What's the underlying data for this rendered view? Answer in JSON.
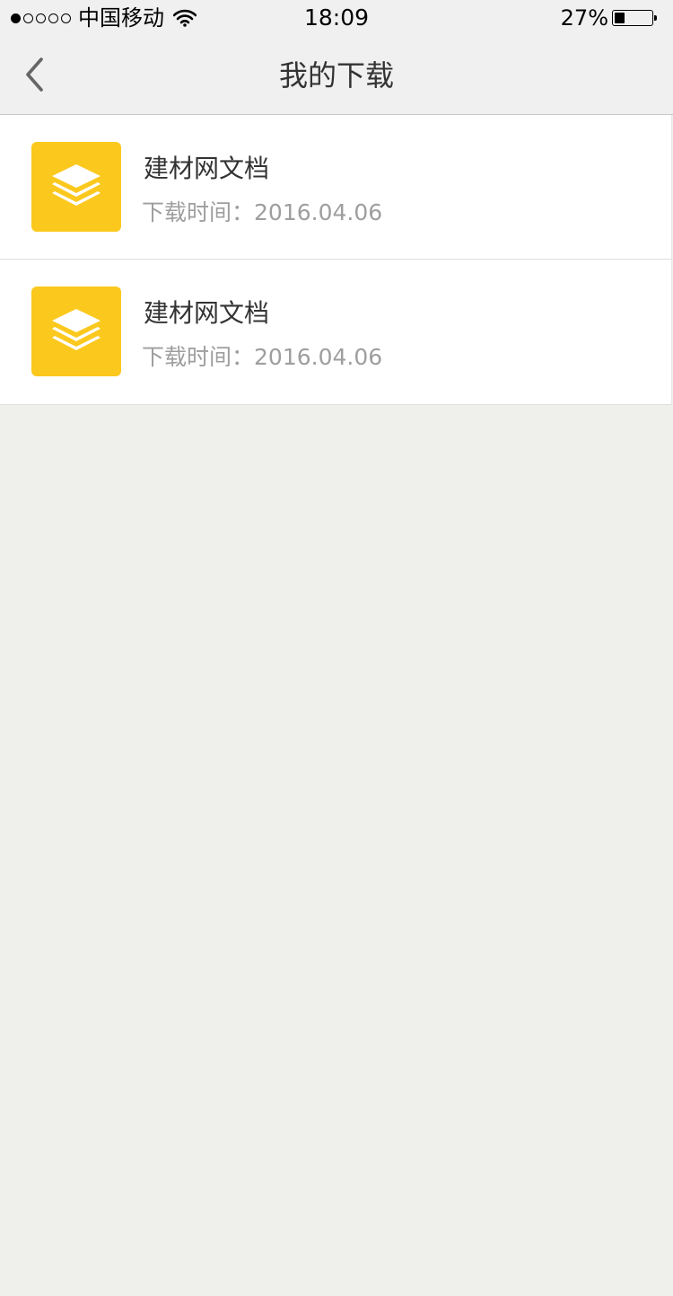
{
  "status_bar": {
    "carrier": "中国移动",
    "time": "18:09",
    "battery_percent": "27%",
    "battery_level": 0.27,
    "signal_bars": 1,
    "signal_total": 5
  },
  "nav": {
    "title": "我的下载",
    "back_icon": "chevron-left-icon"
  },
  "downloads": [
    {
      "title": "建材网文档",
      "time_label": "下载时间：",
      "date": "2016.04.06",
      "icon": "layers-icon",
      "icon_color": "#fbc81e"
    },
    {
      "title": "建材网文档",
      "time_label": "下载时间：",
      "date": "2016.04.06",
      "icon": "layers-icon",
      "icon_color": "#fbc81e"
    }
  ]
}
